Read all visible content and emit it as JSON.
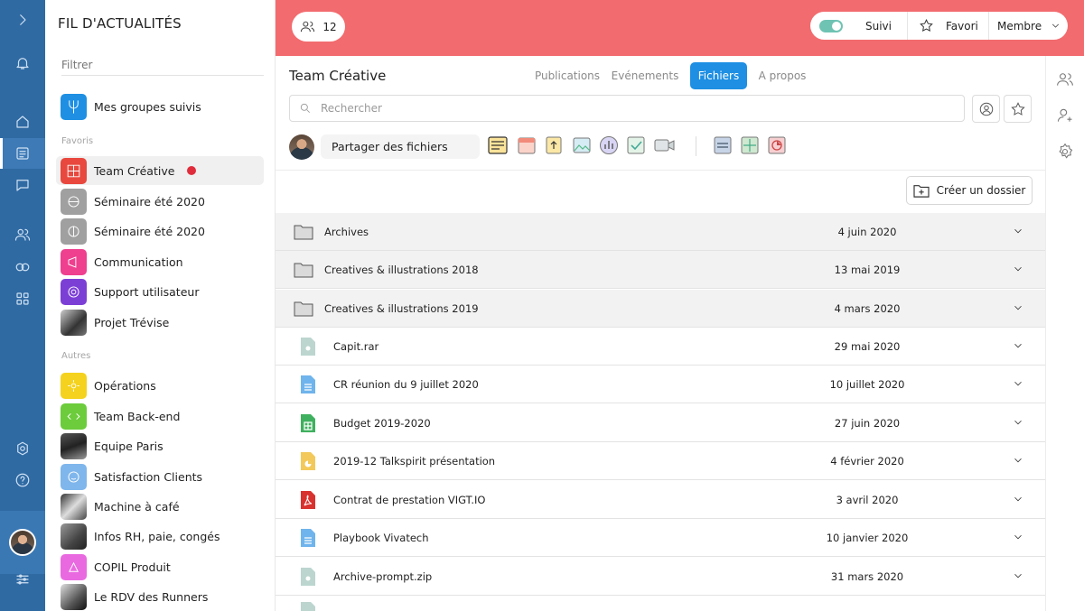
{
  "sidebar": {
    "title": "FIL D'ACTUALITÉS",
    "filter_placeholder": "Filtrer",
    "followed_label": "Mes groupes suivis",
    "favorites_header": "Favoris",
    "others_header": "Autres",
    "favorites": [
      {
        "label": "Team Créative",
        "color": "#e8483e",
        "unread": true
      },
      {
        "label": "Séminaire été 2020",
        "color": "#a0a0a0"
      },
      {
        "label": "Séminaire été 2020",
        "color": "#a0a0a0"
      },
      {
        "label": "Communication",
        "color": "#ef3f8f"
      },
      {
        "label": "Support utilisateur",
        "color": "#7c3fd6"
      },
      {
        "label": "Projet Trévise",
        "color": "photo"
      }
    ],
    "others": [
      {
        "label": "Opérations",
        "color": "#f4d21d"
      },
      {
        "label": "Team Back-end",
        "color": "#6ccc3c"
      },
      {
        "label": "Equipe Paris",
        "color": "photo"
      },
      {
        "label": "Satisfaction Clients",
        "color": "#7fb6ec"
      },
      {
        "label": "Machine à café",
        "color": "photo"
      },
      {
        "label": "Infos RH, paie, congés",
        "color": "photo"
      },
      {
        "label": "COPIL Produit",
        "color": "#e96ae0"
      },
      {
        "label": "Le RDV des Runners",
        "color": "photo"
      }
    ]
  },
  "header": {
    "members_count": "12",
    "follow_label": "Suivi",
    "favorite_label": "Favori",
    "member_label": "Membre",
    "band_color": "#f26b6e"
  },
  "main": {
    "group_name": "Team Créative",
    "tabs": [
      "Publications",
      "Evénements",
      "Fichiers",
      "A propos"
    ],
    "active_tab": "Fichiers",
    "search_placeholder": "Rechercher",
    "share_label": "Partager des fichiers",
    "new_folder_label": "Créer un dossier",
    "accent": "#1e8fe3"
  },
  "files": [
    {
      "name": "Archives",
      "date": "4 juin 2020",
      "kind": "folder"
    },
    {
      "name": "Creatives & illustrations 2018",
      "date": "13 mai 2019",
      "kind": "folder"
    },
    {
      "name": "Creatives & illustrations 2019",
      "date": "4 mars 2020",
      "kind": "folder"
    },
    {
      "name": "Capit.rar",
      "date": "29 mai 2020",
      "kind": "archive"
    },
    {
      "name": "CR réunion du 9 juillet 2020",
      "date": "10 juillet 2020",
      "kind": "doc"
    },
    {
      "name": "Budget 2019-2020",
      "date": "27 juin 2020",
      "kind": "sheet"
    },
    {
      "name": "2019-12 Talkspirit présentation",
      "date": "4 février 2020",
      "kind": "slides"
    },
    {
      "name": "Contrat de prestation VIGT.IO",
      "date": "3 avril 2020",
      "kind": "pdf"
    },
    {
      "name": "Playbook Vivatech",
      "date": "10 janvier 2020",
      "kind": "doc"
    },
    {
      "name": "Archive-prompt.zip",
      "date": "31 mars 2020",
      "kind": "archive"
    }
  ]
}
